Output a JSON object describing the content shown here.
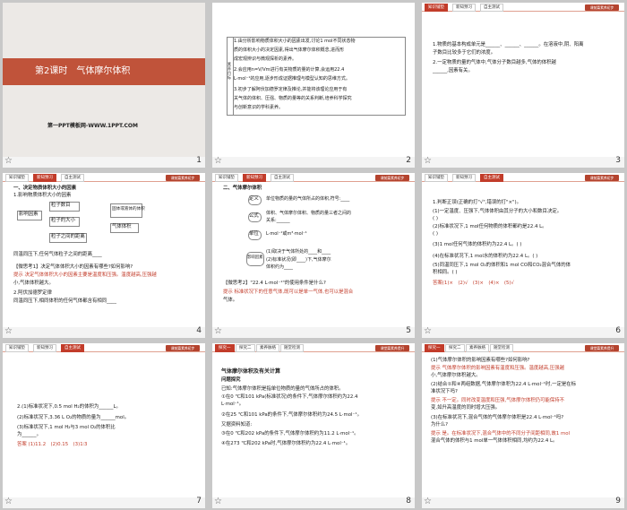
{
  "slides": [
    {
      "number": "1",
      "title": "第2课时　气体摩尔体积",
      "watermark": "第一PPT模板网-WWW.1PPT.COM"
    },
    {
      "number": "2",
      "side": "素养目标",
      "lines": [
        "1.由分析影响物质体积大小的因素出发,讨论1 mol不同状态物",
        "质的体积大小的决定因素,得出气体摩尔体积概念,进而形",
        "成宏观辨识与微观探析的素养。",
        "2.会应用n=V/Vm进行有关物质的量的计算,会运用22.4",
        "L·mol⁻¹的应用,逐步形成证据推理与模型认知的思维方式。",
        "3.初步了解阿伏加德罗定律及推论,并能将该理论应用于有",
        "关气体的体积、压强、物质的量等的关系判断,培养科学探究",
        "与创新意识的学科素养。"
      ]
    },
    {
      "number": "3",
      "tabs": [
        "知识铺垫",
        "新知预习",
        "自主测试"
      ],
      "logo": "课前篇素养初步",
      "lines": [
        "1.物质的基本构成单元是______、______、______。在溶液中,阴、阳离",
        "子数目比较多于它们的浓度。",
        "2.一定物质的量的气体中,气体分子数目越多,气体的体积越",
        "______,因素有关。"
      ]
    },
    {
      "number": "4",
      "tabs": [
        "知识铺垫",
        "新知预习",
        "自主测试"
      ],
      "logo": "课前篇素养初步",
      "lines": [
        "一、决定物质体积大小的因素",
        "1.影响物质体积大小的因素",
        "同温同压下,任何气体粒子之间的距离____",
        "【微思考1】决定气体体积大小的因素有哪些?如何影响?",
        "提示 决定气体体积大小的因素主要是温度和压强。温度越高,压强越",
        "小,气体体积越大。",
        "2.阿伏加德罗定律",
        "同温同压下,相同体积的任何气体都含有相同____"
      ],
      "diagram": {
        "root": "影响因素",
        "a": "粒子数目",
        "b": "粒子的大小",
        "c": "粒子之间的距离",
        "d": "固体或液体的体积",
        "e": "气体体积"
      }
    },
    {
      "number": "5",
      "tabs": [
        "知识铺垫",
        "新知预习",
        "自主测试"
      ],
      "logo": "课前篇素养初步",
      "lines": [
        "二、气体摩尔体积",
        "单位物质的量的气体所占的体积,符号:____",
        "体积、气体摩尔体积、物质的量三者之间的",
        "关系:______",
        "L·mol⁻¹或m³·mol⁻¹",
        "(1)取决于气体所处的____和____",
        "(2)标准状况(即____)下,气体摩尔",
        "体积约为____",
        "【微思考2】\"22.4 L·mol⁻¹\"的使用条件是什么?",
        "提示 标准状况下的任意气体,既可以是单一气体,也可以是混合",
        "气体。"
      ],
      "nodes": [
        "定义",
        "公式",
        "单位",
        "影响因素"
      ]
    },
    {
      "number": "6",
      "tabs": [
        "知识铺垫",
        "新知预习",
        "自主测试"
      ],
      "logo": "课前篇素养初步",
      "lines": [
        "1.判断正误(正确的打\"√\",错误的打\"×\")。",
        "(1)一定温度、压强下,气体体积由其分子的大小和数目决定。",
        "(     )",
        "(2)标准状况下,1 mol任何物质的体积都约是22.4 L。",
        "(     )",
        "(3)1 mol任何气体的体积约为22.4 L。(     )",
        "(4)在标准状况下,1 mol水的体积约为22.4 L。(     )",
        "(5)同温同压下,1 mol O₂的体积和1 mol CO和CO₂混合气体的体",
        "积相同。(     )",
        "答案(1)×　(2)√　(3)×　(4)×　(5)√"
      ]
    },
    {
      "number": "7",
      "tabs": [
        "知识铺垫",
        "新知预习",
        "自主测试"
      ],
      "logo": "课前篇素养初步",
      "lines": [
        "2.(1)标准状况下,0.5 mol H₂的体积为______L。",
        "(2)标准状况下,3.36 L O₂的物质的量为______mol。",
        "(3)标准状况下,1 mol H₂与3 mol O₂的体积比",
        "为______。",
        "答案 (1)11.2　(2)0.15　(3)1∶3"
      ]
    },
    {
      "number": "8",
      "tabs": [
        "探究一",
        "探究二",
        "素养脉络",
        "随堂检测"
      ],
      "logo": "课堂篇素养提升",
      "lines": [
        "气体摩尔体积及有关计算",
        "问题探究",
        "已知:气体摩尔体积是指单位物质的量的气体所占的体积。",
        "①在0 ℃和101 kPa(标准状况)的条件下,气体摩尔体积约为22.4",
        "L·mol⁻¹。",
        "②在25 ℃和101 kPa的条件下,气体摩尔体积约为24.5 L·mol⁻¹。",
        "又据资料知道:",
        "③在0 ℃和202 kPa的条件下,气体摩尔体积约为11.2 L·mol⁻¹。",
        "④在273 ℃和202 kPa时,气体摩尔体积约为22.4 L·mol⁻¹。"
      ]
    },
    {
      "number": "9",
      "tabs": [
        "探究一",
        "探究二",
        "素养脉络",
        "随堂检测"
      ],
      "logo": "课堂篇素养提升",
      "lines": [
        "(1)气体摩尔体积的影响因素有哪些?如何影响?",
        "提示 气体摩尔体积的影响因素有温度和压强。温度越高,压强越",
        "小,气体摩尔体积越大。",
        "(2)结合①和④两组数据,气体摩尔体积为22.4 L·mol⁻¹时,一定是在标",
        "准状况下吗?",
        "提示 不一定。同时改变温度和压强,气体摩尔体积仍可能保持不",
        "变,如升高温度的同时增大压强。",
        "(3)在标准状况下,混合气体的气体摩尔体积是22.4 L·mol⁻¹吗?",
        "为什么?",
        "提示 是。在标准状况下,混合气体中的不同分子间距相同,故1 mol",
        "混合气体的体积与1 mol单一气体体积相同,均约为22.4 L。"
      ]
    }
  ],
  "colors": {
    "accent": "#c23c2a",
    "banner": "#c0533a",
    "background": "#c8c8c8"
  }
}
